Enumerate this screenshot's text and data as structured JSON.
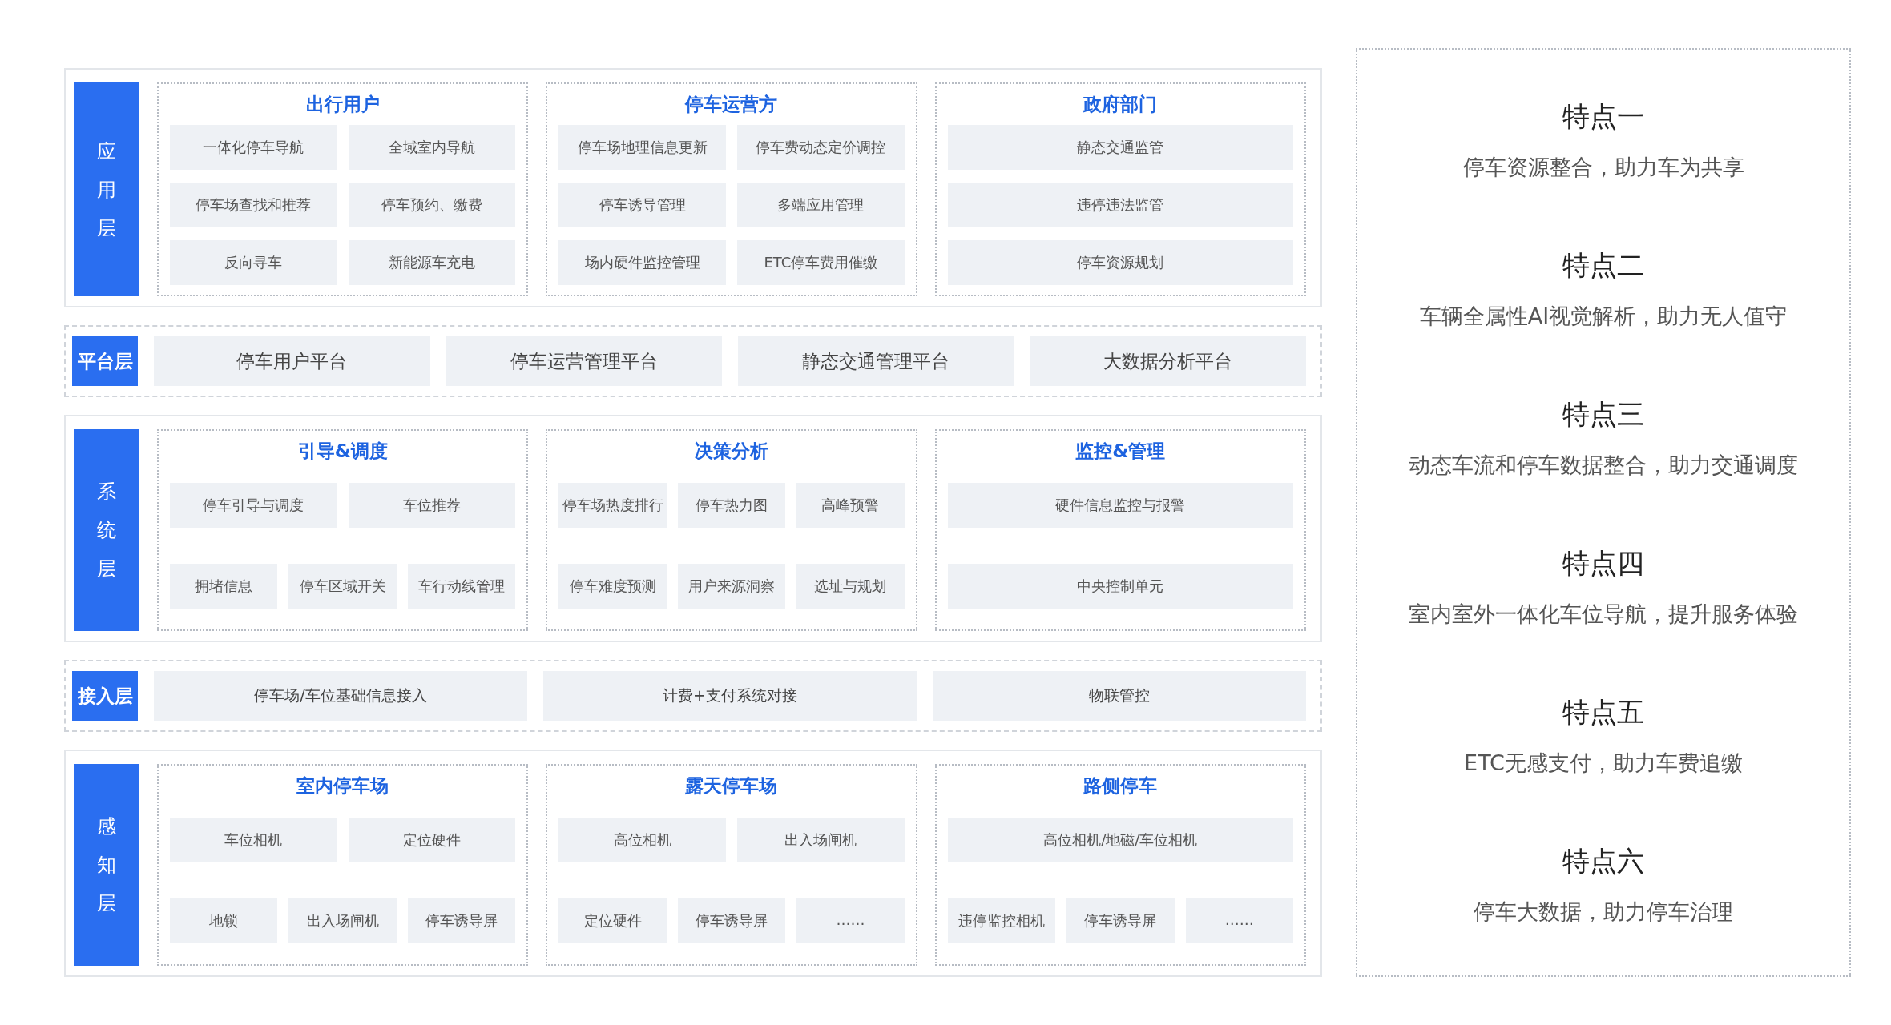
{
  "layers": [
    {
      "kind": "groups",
      "label": "应用层",
      "groups": [
        {
          "title": "出行用户",
          "rows": [
            {
              "tiles": [
                "一体化停车导航",
                "全域室内导航"
              ]
            },
            {
              "tiles": [
                "停车场查找和推荐",
                "停车预约、缴费"
              ]
            },
            {
              "tiles": [
                "反向寻车",
                "新能源车充电"
              ]
            }
          ]
        },
        {
          "title": "停车运营方",
          "rows": [
            {
              "tiles": [
                "停车场地理信息更新",
                "停车费动态定价调控"
              ]
            },
            {
              "tiles": [
                "停车诱导管理",
                "多端应用管理"
              ]
            },
            {
              "tiles": [
                "场内硬件监控管理",
                "ETC停车费用催缴"
              ]
            }
          ]
        },
        {
          "title": "政府部门",
          "rows": [
            {
              "tiles": [
                "静态交通监管"
              ]
            },
            {
              "tiles": [
                "违停违法监管"
              ]
            },
            {
              "tiles": [
                "停车资源规划"
              ]
            }
          ]
        }
      ]
    },
    {
      "kind": "flat",
      "label": "平台层",
      "items": [
        "停车用户平台",
        "停车运营管理平台",
        "静态交通管理平台",
        "大数据分析平台"
      ]
    },
    {
      "kind": "groups",
      "label": "系统层",
      "groups": [
        {
          "title": "引导&调度",
          "rows": [
            {
              "tiles": [
                "停车引导与调度",
                "车位推荐"
              ]
            },
            {
              "tiles": [
                "拥堵信息",
                "停车区域开关",
                "车行动线管理"
              ]
            }
          ]
        },
        {
          "title": "决策分析",
          "rows": [
            {
              "tiles": [
                "停车场热度排行",
                "停车热力图",
                "高峰预警"
              ]
            },
            {
              "tiles": [
                "停车难度预测",
                "用户来源洞察",
                "选址与规划"
              ]
            }
          ]
        },
        {
          "title": "监控&管理",
          "rows": [
            {
              "tiles": [
                "硬件信息监控与报警"
              ]
            },
            {
              "tiles": [
                "中央控制单元"
              ]
            }
          ]
        }
      ]
    },
    {
      "kind": "flat",
      "label": "接入层",
      "items": [
        "停车场/车位基础信息接入",
        "计费+支付系统对接",
        "物联管控"
      ]
    },
    {
      "kind": "groups",
      "label": "感知层",
      "groups": [
        {
          "title": "室内停车场",
          "rows": [
            {
              "tiles": [
                "车位相机",
                "定位硬件"
              ]
            },
            {
              "tiles": [
                "地锁",
                "出入场闸机",
                "停车诱导屏"
              ]
            }
          ]
        },
        {
          "title": "露天停车场",
          "rows": [
            {
              "tiles": [
                "高位相机",
                "出入场闸机"
              ]
            },
            {
              "tiles": [
                "定位硬件",
                "停车诱导屏",
                "……"
              ]
            }
          ]
        },
        {
          "title": "路侧停车",
          "rows": [
            {
              "tiles": [
                "高位相机/地磁/车位相机"
              ]
            },
            {
              "tiles": [
                "违停监控相机",
                "停车诱导屏",
                "……"
              ]
            }
          ]
        }
      ]
    }
  ],
  "features": [
    {
      "title": "特点一",
      "text": "停车资源整合，助力车为共享"
    },
    {
      "title": "特点二",
      "text": "车辆全属性AI视觉解析，助力无人值守"
    },
    {
      "title": "特点三",
      "text": "动态车流和停车数据整合，助力交通调度"
    },
    {
      "title": "特点四",
      "text": "室内室外一体化车位导航，提升服务体验"
    },
    {
      "title": "特点五",
      "text": "ETC无感支付，助力车费追缴"
    },
    {
      "title": "特点六",
      "text": "停车大数据，助力停车治理"
    }
  ]
}
